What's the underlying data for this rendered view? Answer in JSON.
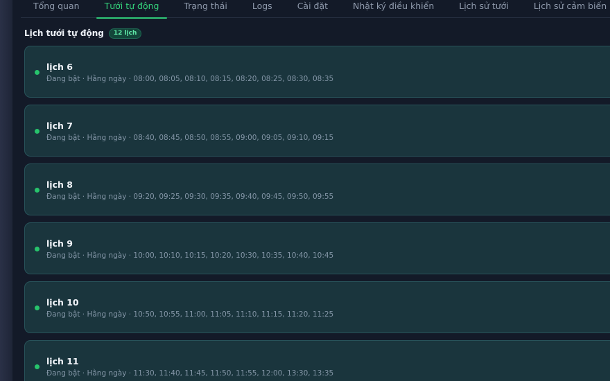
{
  "tabs": [
    {
      "label": "Tổng quan",
      "active": false
    },
    {
      "label": "Tưới tự động",
      "active": true
    },
    {
      "label": "Trạng thái",
      "active": false
    },
    {
      "label": "Logs",
      "active": false
    },
    {
      "label": "Cài đặt",
      "active": false
    },
    {
      "label": "Nhật ký điều khiển",
      "active": false
    },
    {
      "label": "Lịch sử tưới",
      "active": false
    },
    {
      "label": "Lịch sử cảm biến",
      "active": false
    }
  ],
  "schedules_section": {
    "title": "Lịch tưới tự động",
    "count_badge": "12 lịch"
  },
  "schedules": [
    {
      "name": "lịch 6",
      "summary": "Đang bật · Hằng ngày · 08:00, 08:05, 08:10, 08:15, 08:20, 08:25, 08:30, 08:35",
      "status": "on"
    },
    {
      "name": "lịch 7",
      "summary": "Đang bật · Hằng ngày · 08:40, 08:45, 08:50, 08:55, 09:00, 09:05, 09:10, 09:15",
      "status": "on"
    },
    {
      "name": "lịch 8",
      "summary": "Đang bật · Hằng ngày · 09:20, 09:25, 09:30, 09:35, 09:40, 09:45, 09:50, 09:55",
      "status": "on"
    },
    {
      "name": "lịch 9",
      "summary": "Đang bật · Hằng ngày · 10:00, 10:10, 10:15, 10:20, 10:30, 10:35, 10:40, 10:45",
      "status": "on"
    },
    {
      "name": "lịch 10",
      "summary": "Đang bật · Hằng ngày · 10:50, 10:55, 11:00, 11:05, 11:10, 11:15, 11:20, 11:25",
      "status": "on"
    },
    {
      "name": "lịch 11",
      "summary": "Đang bật · Hằng ngày · 11:30, 11:40, 11:45, 11:50, 11:55, 12:00, 13:30, 13:35",
      "status": "on"
    }
  ],
  "colors": {
    "accent": "#2fc978",
    "status_on": "#27c46c",
    "card_bg": "#1a353d",
    "page_bg": "#131a28"
  }
}
